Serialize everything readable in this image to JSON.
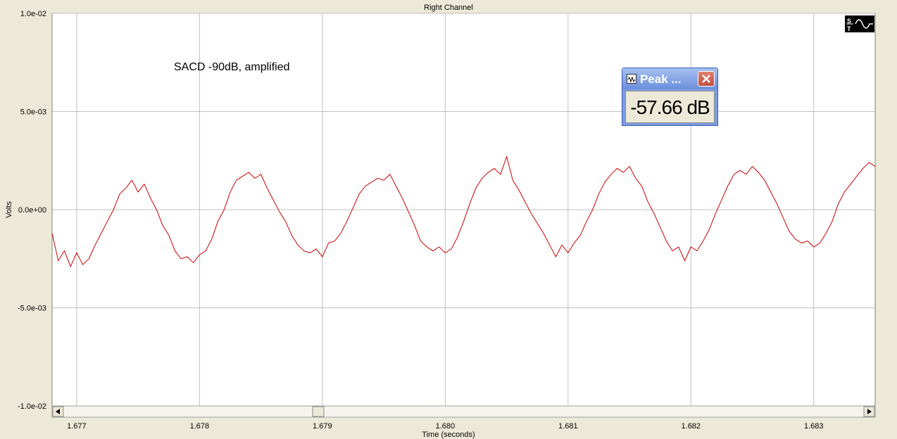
{
  "window": {
    "title": "Right Channel"
  },
  "annotation": "SACD -90dB, amplified",
  "peak_meter": {
    "title": "Peak ...",
    "value": "-57.66 dB"
  },
  "colors": {
    "trace": "#cc0000",
    "grid": "#c0c0c0",
    "background": "#ffffff",
    "frame": "#ece9d8"
  },
  "icons": {
    "peak_window_icon": "waveform-icon",
    "close": "close-icon",
    "logo": "scope-logo-icon"
  },
  "chart_data": {
    "type": "line",
    "title": "Right Channel",
    "xlabel": "Time (seconds)",
    "ylabel": "Volts",
    "xlim": [
      1.6768,
      1.6835
    ],
    "ylim": [
      -0.01,
      0.01
    ],
    "grid": true,
    "x_ticks": [
      1.677,
      1.678,
      1.679,
      1.68,
      1.681,
      1.682,
      1.683
    ],
    "x_tick_labels": [
      "1.677",
      "1.678",
      "1.679",
      "1.680",
      "1.681",
      "1.682",
      "1.683"
    ],
    "y_ticks": [
      0.01,
      0.005,
      0.0,
      -0.005,
      -0.01
    ],
    "y_tick_labels": [
      "1.0e-02",
      "5.0e-03",
      "0.0e+00",
      "-5.0e-03",
      "-1.0e-02"
    ],
    "series": [
      {
        "x": [
          1.6768,
          1.67685,
          1.6769,
          1.67695,
          1.677,
          1.67705,
          1.6771,
          1.67715,
          1.6772,
          1.67725,
          1.6773,
          1.67735,
          1.6774,
          1.67745,
          1.6775,
          1.67755,
          1.6776,
          1.67765,
          1.6777,
          1.67775,
          1.6778,
          1.67785,
          1.6779,
          1.67795,
          1.678,
          1.67805,
          1.6781,
          1.67815,
          1.6782,
          1.67825,
          1.6783,
          1.67835,
          1.6784,
          1.67845,
          1.6785,
          1.67855,
          1.6786,
          1.67865,
          1.6787,
          1.67875,
          1.6788,
          1.67885,
          1.6789,
          1.67895,
          1.679,
          1.67905,
          1.6791,
          1.67915,
          1.6792,
          1.67925,
          1.6793,
          1.67935,
          1.6794,
          1.67945,
          1.6795,
          1.67955,
          1.6796,
          1.67965,
          1.6797,
          1.67975,
          1.6798,
          1.67985,
          1.6799,
          1.67995,
          1.68,
          1.68005,
          1.6801,
          1.68015,
          1.6802,
          1.68025,
          1.6803,
          1.68035,
          1.6804,
          1.68045,
          1.6805,
          1.68055,
          1.6806,
          1.68065,
          1.6807,
          1.68075,
          1.6808,
          1.68085,
          1.6809,
          1.68095,
          1.681,
          1.68105,
          1.6811,
          1.68115,
          1.6812,
          1.68125,
          1.6813,
          1.68135,
          1.6814,
          1.68145,
          1.6815,
          1.68155,
          1.6816,
          1.68165,
          1.6817,
          1.68175,
          1.6818,
          1.68185,
          1.6819,
          1.68195,
          1.682,
          1.68205,
          1.6821,
          1.68215,
          1.6822,
          1.68225,
          1.6823,
          1.68235,
          1.6824,
          1.68245,
          1.6825,
          1.68255,
          1.6826,
          1.68265,
          1.6827,
          1.68275,
          1.6828,
          1.68285,
          1.6829,
          1.68295,
          1.683,
          1.68305,
          1.6831,
          1.68315,
          1.6832,
          1.68325,
          1.6833,
          1.68335,
          1.6834,
          1.68345,
          1.6835
        ],
        "y": [
          -0.0012,
          -0.0026,
          -0.0021,
          -0.0029,
          -0.0022,
          -0.0028,
          -0.0025,
          -0.0018,
          -0.0012,
          -0.0006,
          0.0,
          0.0008,
          0.0011,
          0.0015,
          0.0009,
          0.0013,
          0.0006,
          0.0,
          -0.0008,
          -0.0013,
          -0.0021,
          -0.0025,
          -0.0024,
          -0.0027,
          -0.0023,
          -0.0021,
          -0.0015,
          -0.0006,
          0.0,
          0.0009,
          0.0015,
          0.0017,
          0.0019,
          0.0016,
          0.0018,
          0.0011,
          0.0005,
          -0.0001,
          -0.0006,
          -0.0013,
          -0.0018,
          -0.0021,
          -0.0022,
          -0.002,
          -0.0024,
          -0.0017,
          -0.0016,
          -0.0012,
          -0.0006,
          0.0001,
          0.0008,
          0.0012,
          0.0014,
          0.0016,
          0.0015,
          0.0018,
          0.0012,
          0.0006,
          -0.0001,
          -0.0008,
          -0.0016,
          -0.0019,
          -0.0021,
          -0.0019,
          -0.0022,
          -0.002,
          -0.0014,
          -0.0006,
          0.0003,
          0.0011,
          0.0016,
          0.0019,
          0.0021,
          0.0018,
          0.0027,
          0.0015,
          0.001,
          0.0004,
          -0.0002,
          -0.0007,
          -0.0012,
          -0.0018,
          -0.0024,
          -0.0018,
          -0.0022,
          -0.0017,
          -0.0013,
          -0.0006,
          0.0,
          0.0008,
          0.0014,
          0.0018,
          0.0021,
          0.0019,
          0.0022,
          0.0016,
          0.0012,
          0.0004,
          -0.0002,
          -0.0009,
          -0.0016,
          -0.0021,
          -0.0019,
          -0.0026,
          -0.0019,
          -0.0021,
          -0.0016,
          -0.001,
          -0.0002,
          0.0005,
          0.0012,
          0.0018,
          0.002,
          0.0018,
          0.0022,
          0.0019,
          0.0015,
          0.0009,
          0.0003,
          -0.0004,
          -0.0011,
          -0.0015,
          -0.0017,
          -0.0016,
          -0.0019,
          -0.0017,
          -0.0012,
          -0.0006,
          0.0003,
          0.0009,
          0.0013,
          0.0017,
          0.0021,
          0.0024,
          0.0022
        ]
      }
    ]
  }
}
